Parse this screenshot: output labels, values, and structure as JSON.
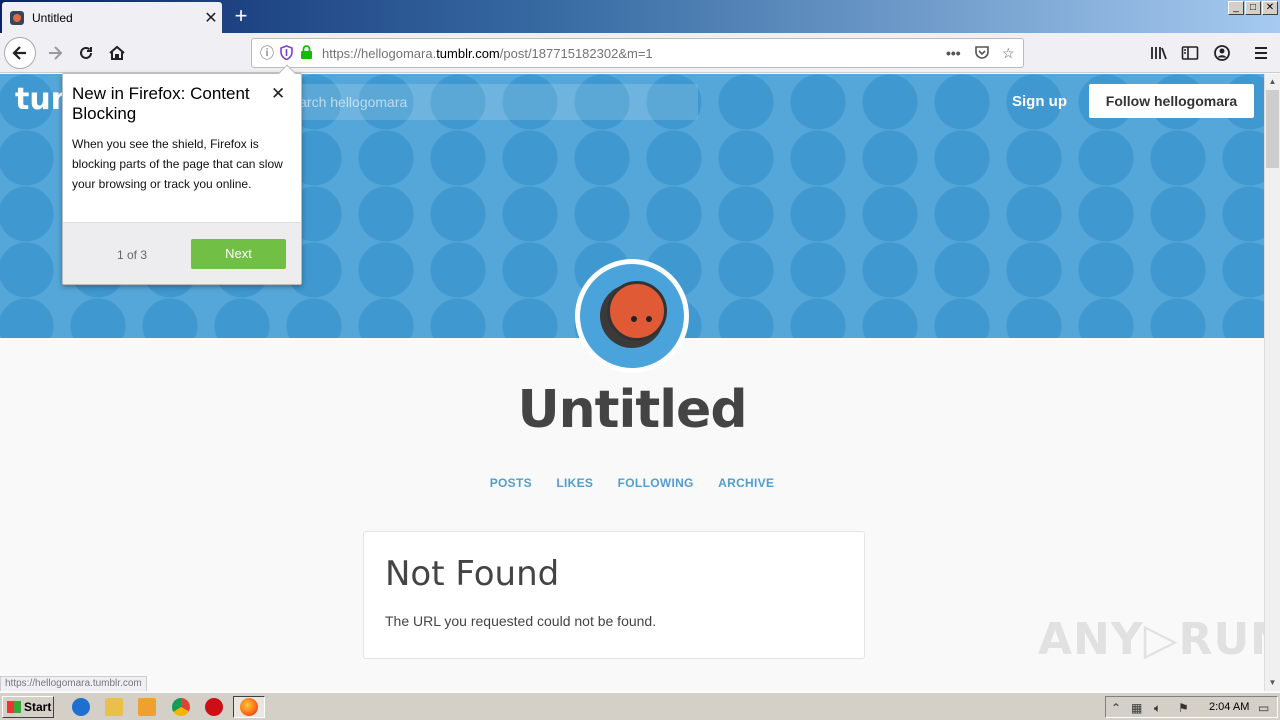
{
  "browser": {
    "tab_title": "Untitled",
    "tab_close": "✕",
    "new_tab": "+",
    "url_prefix": "https://hellogomara.",
    "url_domain": "tumblr.com",
    "url_suffix": "/post/187715182302&m=1",
    "url_more": "•••",
    "status_url": "https://hellogomara.tumblr.com"
  },
  "site": {
    "logo": "tumblr",
    "search_placeholder": "Search hellogomara",
    "signup_label": "Sign up",
    "follow_label": "Follow hellogomara",
    "blog_title": "Untitled",
    "nav": [
      "POSTS",
      "LIKES",
      "FOLLOWING",
      "ARCHIVE"
    ],
    "error_title": "Not Found",
    "error_message": "The URL you requested could not be found."
  },
  "popup": {
    "title": "New in Firefox: Content Blocking",
    "body": "When you see the shield, Firefox is blocking parts of the page that can slow your browsing or track you online.",
    "step": "1 of 3",
    "next_label": "Next",
    "close": "✕"
  },
  "taskbar": {
    "start_label": "Start",
    "clock": "2:04 AM"
  },
  "watermark": "ANY▷RUN",
  "colors": {
    "header_blue": "#55a7da",
    "link_blue": "#529ecc",
    "next_green": "#71bf45",
    "avatar_orange": "#e05a36"
  }
}
